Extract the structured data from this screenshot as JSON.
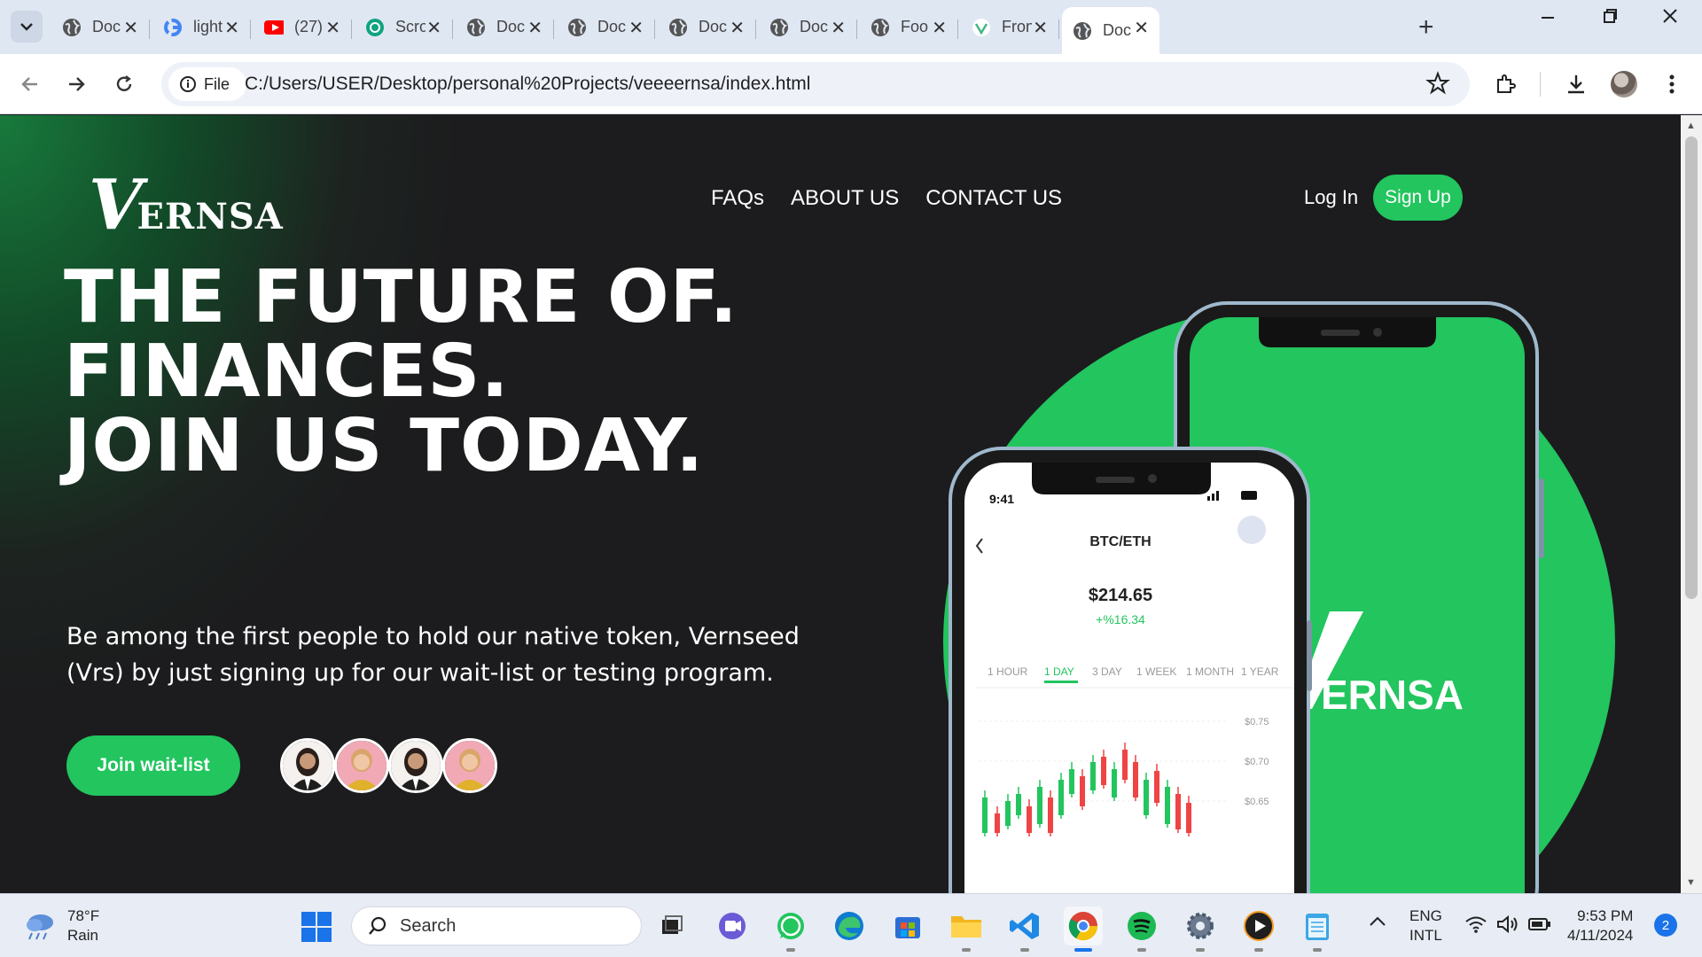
{
  "browser": {
    "tabs": [
      {
        "title": "Doc",
        "icon": "globe-icon"
      },
      {
        "title": "light",
        "icon": "google-icon"
      },
      {
        "title": "(27)",
        "icon": "youtube-icon"
      },
      {
        "title": "Scro",
        "icon": "chatgpt-icon"
      },
      {
        "title": "Doc",
        "icon": "globe-icon"
      },
      {
        "title": "Doc",
        "icon": "globe-icon"
      },
      {
        "title": "Doc",
        "icon": "globe-icon"
      },
      {
        "title": "Doc",
        "icon": "globe-icon"
      },
      {
        "title": "Foo",
        "icon": "globe-icon"
      },
      {
        "title": "Fron",
        "icon": "vue-icon"
      },
      {
        "title": "Doc",
        "icon": "globe-icon",
        "active": true
      }
    ],
    "address_chip": "File",
    "url": "C:/Users/USER/Desktop/personal%20Projects/veeeernsa/index.html"
  },
  "site": {
    "logo_initial": "V",
    "logo_rest": "ERNSA",
    "nav": [
      "FAQs",
      "ABOUT US",
      "CONTACT US"
    ],
    "login": "Log In",
    "signup": "Sign Up",
    "hero_lines": [
      "THE FUTURE OF.",
      "FINANCES.",
      "JOIN US TODAY."
    ],
    "subtitle": "Be among the first people to hold our native token, Vernseed (Vrs) by just signing up for our wait-list or testing program.",
    "cta": "Join wait-list",
    "accent_color": "#22c55e"
  },
  "phone_app": {
    "time": "9:41",
    "pair": "BTC/ETH",
    "price": "$214.65",
    "change": "+%16.34",
    "ranges": [
      "1 HOUR",
      "1 DAY",
      "3 DAY",
      "1 WEEK",
      "1 MONTH",
      "1 YEAR"
    ],
    "active_range": "1 DAY",
    "price_ticks": [
      "$0.75",
      "$0.70",
      "$0.65"
    ],
    "back_logo": "ERNSA"
  },
  "taskbar": {
    "temp": "78°F",
    "condition": "Rain",
    "search": "Search",
    "lang1": "ENG",
    "lang2": "INTL",
    "time": "9:53 PM",
    "date": "4/11/2024",
    "notifications": "2"
  }
}
